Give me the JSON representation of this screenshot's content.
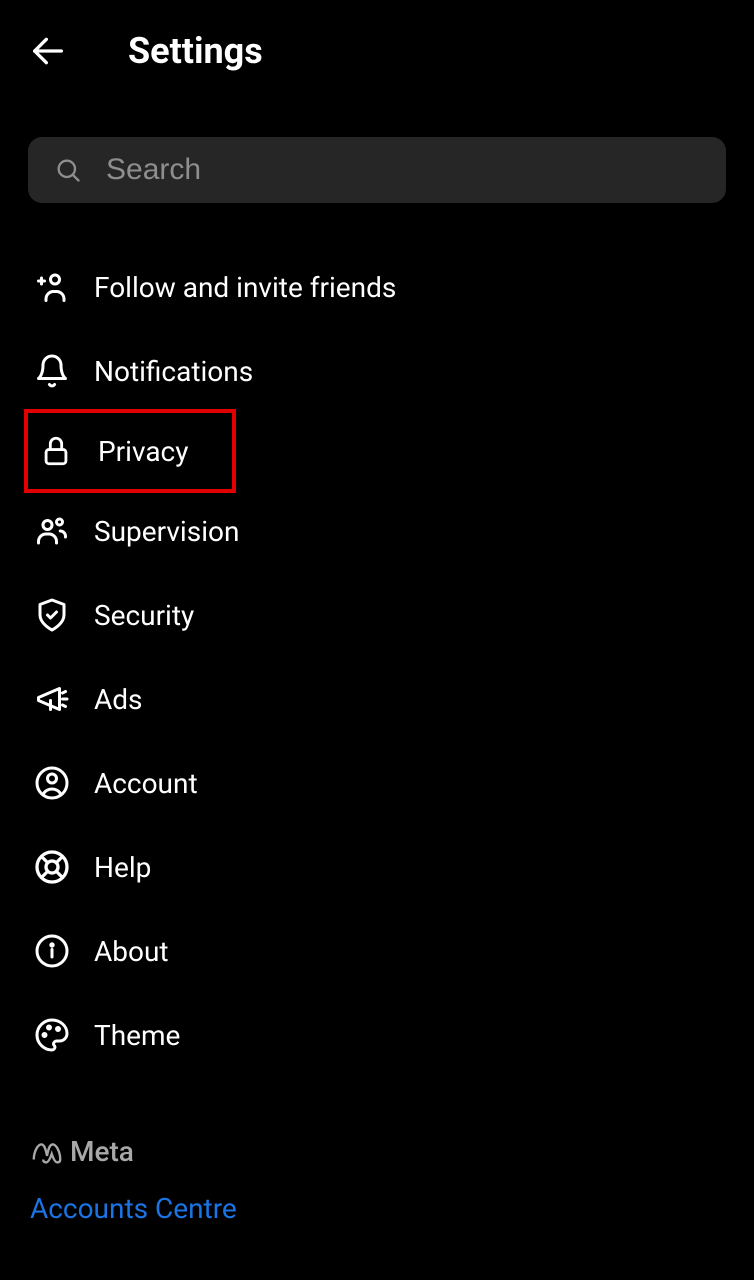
{
  "header": {
    "title": "Settings"
  },
  "search": {
    "placeholder": "Search"
  },
  "menu": {
    "items": [
      {
        "label": "Follow and invite friends",
        "icon": "person-add-icon",
        "highlighted": false
      },
      {
        "label": "Notifications",
        "icon": "bell-icon",
        "highlighted": false
      },
      {
        "label": "Privacy",
        "icon": "lock-icon",
        "highlighted": true
      },
      {
        "label": "Supervision",
        "icon": "people-icon",
        "highlighted": false
      },
      {
        "label": "Security",
        "icon": "shield-check-icon",
        "highlighted": false
      },
      {
        "label": "Ads",
        "icon": "megaphone-icon",
        "highlighted": false
      },
      {
        "label": "Account",
        "icon": "account-circle-icon",
        "highlighted": false
      },
      {
        "label": "Help",
        "icon": "life-ring-icon",
        "highlighted": false
      },
      {
        "label": "About",
        "icon": "info-icon",
        "highlighted": false
      },
      {
        "label": "Theme",
        "icon": "palette-icon",
        "highlighted": false
      }
    ]
  },
  "footer": {
    "brand": "Meta",
    "link": "Accounts Centre"
  }
}
